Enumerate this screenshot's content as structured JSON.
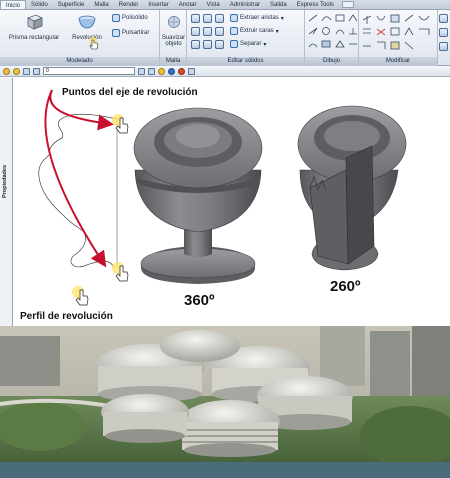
{
  "ribbon": {
    "tabs": [
      "Inicio",
      "Sólido",
      "Superficie",
      "Malla",
      "Render",
      "Insertar",
      "Anotar",
      "Vista",
      "Administrar",
      "Salida",
      "Express Tools"
    ],
    "active_tab": "Inicio",
    "panels": {
      "modelado": {
        "title": "Modelado",
        "prisma": "Prisma rectangular",
        "revolucion": "Revolución",
        "polisolido": "Polisólido",
        "pulsartirar": "Pulsartirar"
      },
      "malla": {
        "title": "Malla",
        "suavizar": "Suavizar objeto"
      },
      "editar": {
        "title": "Editar sólidos",
        "extraer_aristas": "Extraer aristas",
        "extruir_caras": "Extruir caras",
        "separar": "Separar"
      },
      "dibujo": {
        "title": "Dibujo"
      },
      "modificar": {
        "title": "Modificar"
      }
    }
  },
  "toolbar": {
    "layer": "0"
  },
  "palette": {
    "label": "Propiedades"
  },
  "drawing": {
    "axis_points_label": "Puntos del eje de revolución",
    "profile_label": "Perfil de revolución",
    "result_360": "360º",
    "result_260": "260º"
  },
  "colors": {
    "arrow": "#c8102e",
    "solid": "#6e7073",
    "ribbon": "#e3e8ef"
  }
}
